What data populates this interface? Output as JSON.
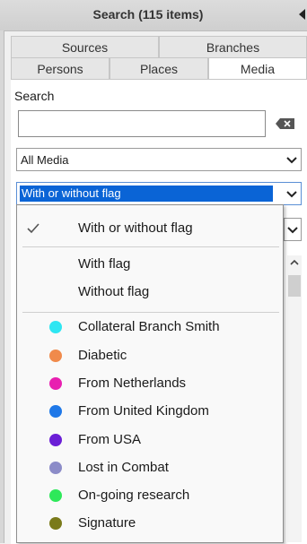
{
  "header": {
    "title": "Search (115 items)"
  },
  "tabs": {
    "back_row": [
      "Sources",
      "Branches"
    ],
    "front_row": [
      "Persons",
      "Places",
      "Media"
    ],
    "active": "Media"
  },
  "search": {
    "label": "Search",
    "value": ""
  },
  "media_filter": {
    "selected": "All Media"
  },
  "flag_filter": {
    "selected": "With or without flag",
    "options": [
      {
        "label": "With or without flag",
        "checked": true
      },
      {
        "label": "With flag",
        "checked": false
      },
      {
        "label": "Without flag",
        "checked": false
      }
    ],
    "flags": [
      {
        "label": "Collateral Branch Smith",
        "color": "#2ee6f2"
      },
      {
        "label": "Diabetic",
        "color": "#f08a4b"
      },
      {
        "label": "From Netherlands",
        "color": "#e81fb0"
      },
      {
        "label": "From United Kingdom",
        "color": "#1f78e8"
      },
      {
        "label": "From USA",
        "color": "#6b1fd6"
      },
      {
        "label": "Lost in Combat",
        "color": "#8c8cc8"
      },
      {
        "label": "On-going research",
        "color": "#2ee85a"
      },
      {
        "label": "Signature",
        "color": "#7a7a1a"
      }
    ]
  },
  "icons": {
    "clear": "backspace-clear-icon",
    "dropdown": "chevron-down-icon",
    "collapse": "collapse-left-icon",
    "check": "checkmark-icon",
    "scroll_up": "scroll-up-icon"
  }
}
